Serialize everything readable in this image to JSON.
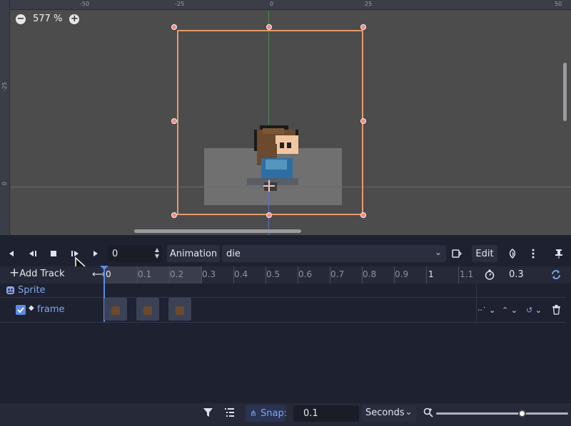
{
  "viewport": {
    "zoom_label": "577 %",
    "ruler_top": [
      "-50",
      "-25",
      "0",
      "25",
      "50"
    ],
    "ruler_left": [
      "-25",
      "0"
    ]
  },
  "toolbar": {
    "frame_value": "0",
    "animation_label": "Animation",
    "animation_selected": "die",
    "edit_label": "Edit"
  },
  "timeline": {
    "add_track_label": "Add Track",
    "ticks": [
      "0",
      "0.1",
      "0.2",
      "0.3",
      "0.4",
      "0.5",
      "0.6",
      "0.7",
      "0.8",
      "0.9",
      "1",
      "1.1"
    ],
    "length_value": "0.3",
    "tracks": {
      "node_name": "Sprite",
      "property_name": "frame"
    }
  },
  "bottom": {
    "snap_label": "Snap:",
    "snap_value": "0.1",
    "units": "Seconds"
  },
  "colors": {
    "accent": "#5d8ae6",
    "selection": "#e59a6a",
    "track_label": "#7fa8f0"
  }
}
